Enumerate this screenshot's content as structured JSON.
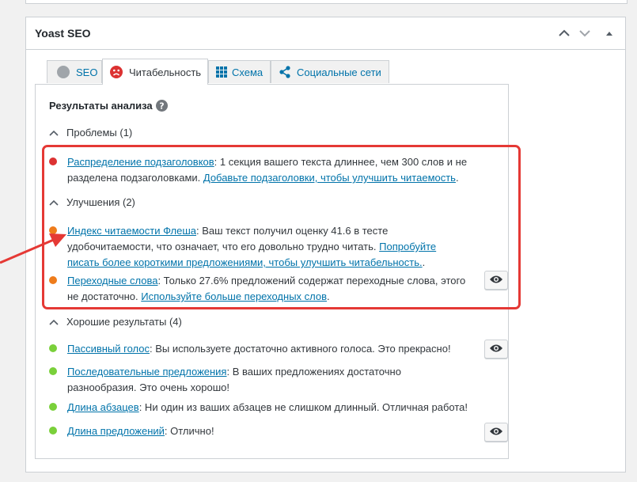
{
  "metabox": {
    "title": "Yoast SEO",
    "tabs": [
      {
        "label": "SEO",
        "icon": "gray-circle-icon"
      },
      {
        "label": "Читабельность",
        "icon": "sad-face-icon"
      },
      {
        "label": "Схема",
        "icon": "grid-icon"
      },
      {
        "label": "Социальные сети",
        "icon": "share-icon"
      }
    ],
    "active_tab": "Читабельность"
  },
  "analysis": {
    "title": "Результаты анализа",
    "problems": {
      "heading": "Проблемы (1)",
      "items": [
        {
          "link": "Распределение подзаголовков",
          "text1": ": 1 секция вашего текста длиннее, чем 300 слов и не разделена подзаголовками. ",
          "link2": "Добавьте подзаголовки, чтобы улучшить читаемость",
          "text2": "."
        }
      ]
    },
    "improvements": {
      "heading": "Улучшения (2)",
      "items": [
        {
          "link": "Индекс читаемости Флеша",
          "text1": ": Ваш текст получил оценку 41.6 в тесте удобочитаемости, что означает, что его довольно трудно читать. ",
          "link2": "Попробуйте писать более короткими предложениями, чтобы улучшить читабельность.",
          "text2": "."
        },
        {
          "link": "Переходные слова",
          "text1": ": Только 27.6% предложений содержат переходные слова, этого не достаточно. ",
          "link2": "Используйте больше переходных слов",
          "text2": "."
        }
      ]
    },
    "good": {
      "heading": "Хорошие результаты (4)",
      "items": [
        {
          "link": "Пассивный голос",
          "text1": ": Вы используете достаточно активного голоса. Это прекрасно!"
        },
        {
          "link": "Последовательные предложения",
          "text1": ": В ваших предложениях достаточно разнообразия. Это очень хорошо!"
        },
        {
          "link": "Длина абзацев",
          "text1": ": Ни один из ваших абзацев не слишком длинный. Отличная работа!"
        },
        {
          "link": "Длина предложений",
          "text1": ": Отлично!"
        }
      ]
    }
  },
  "colors": {
    "bad": "#dc3232",
    "ok": "#ee7c1b",
    "good": "#7ad03a",
    "link": "#0073aa",
    "annotation": "#e53935"
  }
}
